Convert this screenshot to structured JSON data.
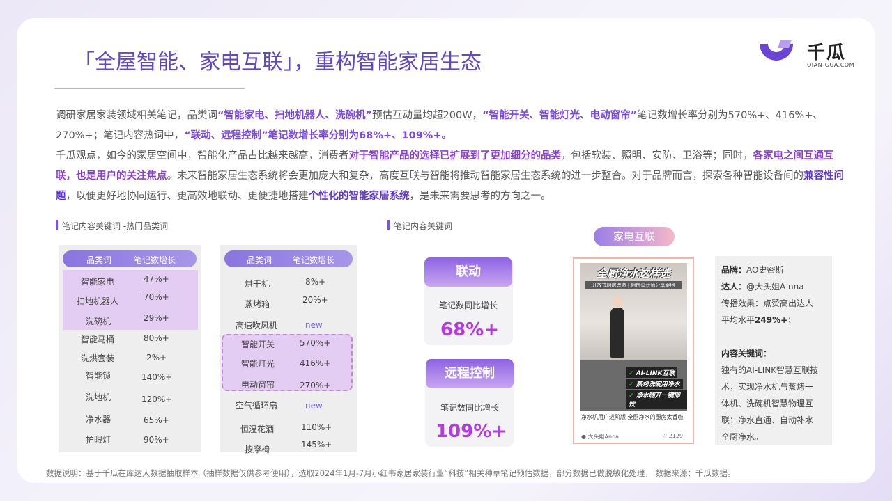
{
  "title": "「全屋智能、家电互联」，重构智能家居生态",
  "logo": {
    "name": "千瓜",
    "sub": "QIAN-GUA.COM"
  },
  "p1": {
    "a": "调研家居家装领域相关笔记，品类词",
    "b": "“智能家电、扫地机器人、洗碗机”",
    "c": "预估互动量均超200W，",
    "d": "“智能开关、智能灯光、电动窗帘”",
    "e": "笔记数增长率分别为570%+、416%+、270%+；笔记内容热词中，",
    "f": "“联动、远程控制”笔记数增长率分别为68%+、109%+。"
  },
  "p2": {
    "a": "千瓜观点，如今的家居空间中，智能化产品占比越来越高，消费者",
    "b": "对于智能产品的选择已扩展到了更加细分的品类",
    "c": "，包括软装、照明、安防、卫浴等；同时，",
    "d": "各家电之间互通互联，也是用户的关注焦点",
    "e": "。未来智能家居生态系统将会更加庞大和复杂，高度互联与智能将推动智能家居生态系统的进一步整合。对于品牌而言，探索各种智能设备间的",
    "f": "兼容性问题",
    "g": "，以便更好地协同运行、更高效地联动、更便捷地搭建",
    "h": "个性化的智能家居系统",
    "i": "，是未来需要思考的方向之一。"
  },
  "section1": "笔记内容关键词 -热门品类词",
  "section2": "笔记内容关键词",
  "table_headers": {
    "col1": "品类词",
    "col2": "笔记数增长"
  },
  "table1": [
    {
      "name": "智能家电",
      "value": "47%+"
    },
    {
      "name": "扫地机器人",
      "value": "70%+"
    },
    {
      "name": "洗碗机",
      "value": "29%+"
    },
    {
      "name": "智能马桶",
      "value": "80%+"
    },
    {
      "name": "洗烘套装",
      "value": "2%+"
    },
    {
      "name": "智能锁",
      "value": "140%+"
    },
    {
      "name": "洗地机",
      "value": "120%+"
    },
    {
      "name": "净水器",
      "value": "65%+"
    },
    {
      "name": "护眼灯",
      "value": "90%+"
    }
  ],
  "table2": [
    {
      "name": "烘干机",
      "value": "8%+"
    },
    {
      "name": "蒸烤箱",
      "value": "20%+"
    },
    {
      "name": "高速吹风机",
      "value": "new"
    },
    {
      "name": "智能开关",
      "value": "570%+"
    },
    {
      "name": "智能灯光",
      "value": "416%+"
    },
    {
      "name": "电动窗帘",
      "value": "270%+"
    },
    {
      "name": "空气循环扇",
      "value": "new"
    },
    {
      "name": "恒温花洒",
      "value": "110%+"
    },
    {
      "name": "按摩椅",
      "value": "145%+"
    }
  ],
  "metrics": [
    {
      "tag": "联动",
      "label": "笔记数同比增长",
      "value": "68%+"
    },
    {
      "tag": "远程控制",
      "label": "笔记数同比增长",
      "value": "109%+"
    }
  ],
  "pill": "家电互联",
  "post": {
    "headline": "全厨净水这样选",
    "subhead": "开放式厨房改造 | 厨房设计师分享案例",
    "badges": [
      "AI-LINK互联",
      "蒸烤洗碗用净水",
      "净水随开一键即饮"
    ],
    "caption": "净水机用户进阶版 全厨净水的厨房太香啦",
    "user": "大头姐Anna",
    "likes": "2129"
  },
  "info": {
    "brand_label": "品牌：",
    "brand": "AO史密斯",
    "kol_label": "达人：",
    "kol": "@大头姐A nna",
    "effect_label": "传播效果：",
    "effect": "点赞高出达人",
    "effect2_a": "平均水平",
    "effect2_b": "249%+",
    "effect2_c": "；",
    "kw_label": "内容关键词：",
    "kw_lines": [
      "独有的AI-LINK智慧互联技",
      "术，实现净水机与蒸烤一",
      "体机、洗碗机智慧物理互",
      "联；净水直通、自动补水",
      "全厨净水。"
    ]
  },
  "footer": "数据说明：基于千瓜在库达人数据抽取样本（抽样数据仅供参考使用），选取2024年1月-7月小红书家居家装行业“科技”相关种草笔记预估数据，部分数据已做脱敏化处理，    数据来源：千瓜数据。"
}
